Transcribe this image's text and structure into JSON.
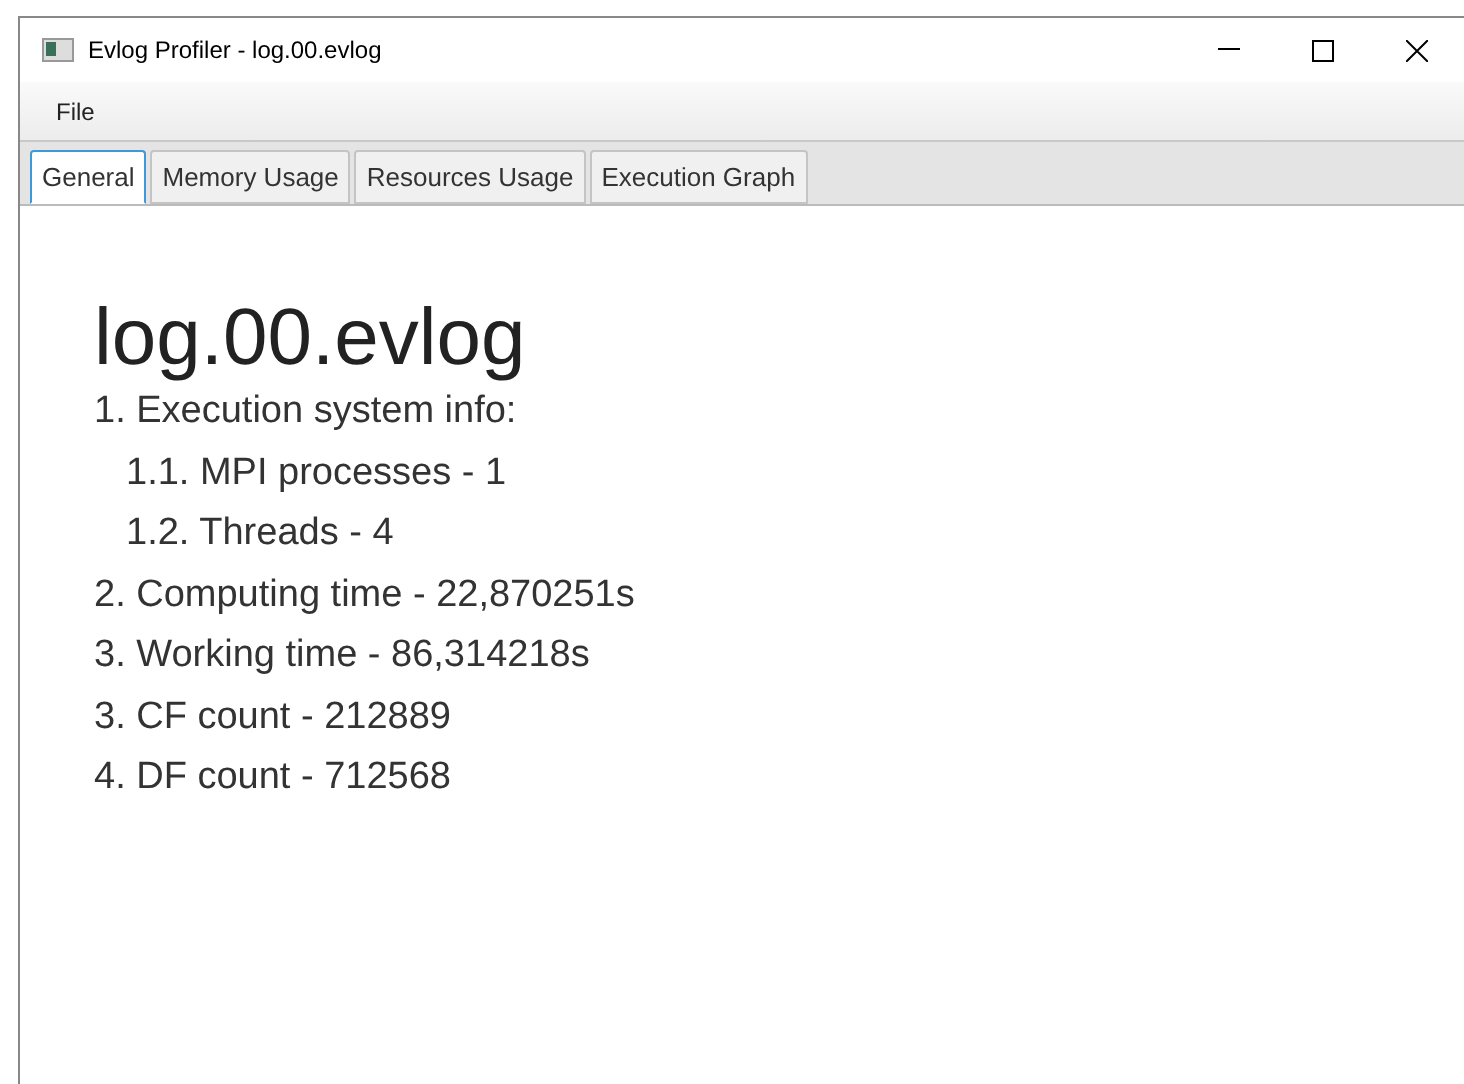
{
  "window": {
    "title": "Evlog Profiler - log.00.evlog"
  },
  "menu": [
    "File"
  ],
  "tabs": [
    {
      "label": "General",
      "selected": true
    },
    {
      "label": "Memory Usage",
      "selected": false
    },
    {
      "label": "Resources Usage",
      "selected": false
    },
    {
      "label": "Execution Graph",
      "selected": false
    }
  ],
  "content": {
    "heading": "log.00.evlog",
    "items": [
      {
        "text": "1. Execution system info:",
        "children": [
          {
            "text": "1.1. MPI processes - 1"
          },
          {
            "text": "1.2. Threads - 4"
          }
        ]
      },
      {
        "text": "2. Computing time - 22,870251s"
      },
      {
        "text": "3. Working time - 86,314218s"
      },
      {
        "text": "3. CF count - 212889"
      },
      {
        "text": "4. DF count - 712568"
      }
    ]
  }
}
